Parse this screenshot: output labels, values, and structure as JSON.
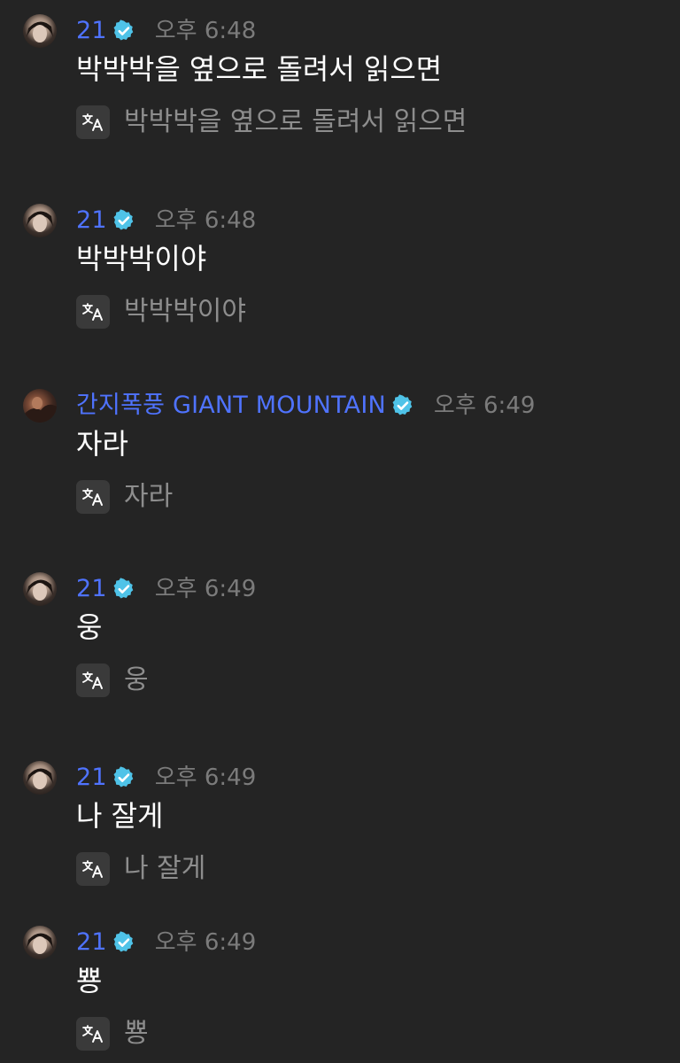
{
  "colors": {
    "background": "#242424",
    "username": "#4f73ff",
    "verified_badge": "#4fc3e8",
    "timestamp": "#7b7b7b",
    "message_text": "#ffffff",
    "translation_text": "#8d8d8d",
    "translate_button_bg": "#3a3a3a"
  },
  "messages": [
    {
      "author": "21",
      "verified": true,
      "time": "오후 6:48",
      "text": "박박박을 옆으로 돌려서 읽으면",
      "translation": "박박박을 옆으로 돌려서 읽으면",
      "avatar": "user-avatar",
      "translate_icon": "translate-icon"
    },
    {
      "author": "21",
      "verified": true,
      "time": "오후 6:48",
      "text": "박박박이야",
      "translation": "박박박이야",
      "avatar": "user-avatar",
      "translate_icon": "translate-icon"
    },
    {
      "author": "간지폭풍 GIANT MOUNTAIN",
      "verified": true,
      "time": "오후 6:49",
      "text": "자라",
      "translation": "자라",
      "avatar": "user-avatar",
      "translate_icon": "translate-icon"
    },
    {
      "author": "21",
      "verified": true,
      "time": "오후 6:49",
      "text": "웅",
      "translation": "웅",
      "avatar": "user-avatar",
      "translate_icon": "translate-icon"
    },
    {
      "author": "21",
      "verified": true,
      "time": "오후 6:49",
      "text": "나 잘게",
      "translation": "나 잘게",
      "avatar": "user-avatar",
      "translate_icon": "translate-icon"
    },
    {
      "author": "21",
      "verified": true,
      "time": "오후 6:49",
      "text": "뿅",
      "translation": "뿅",
      "avatar": "user-avatar",
      "translate_icon": "translate-icon"
    }
  ]
}
